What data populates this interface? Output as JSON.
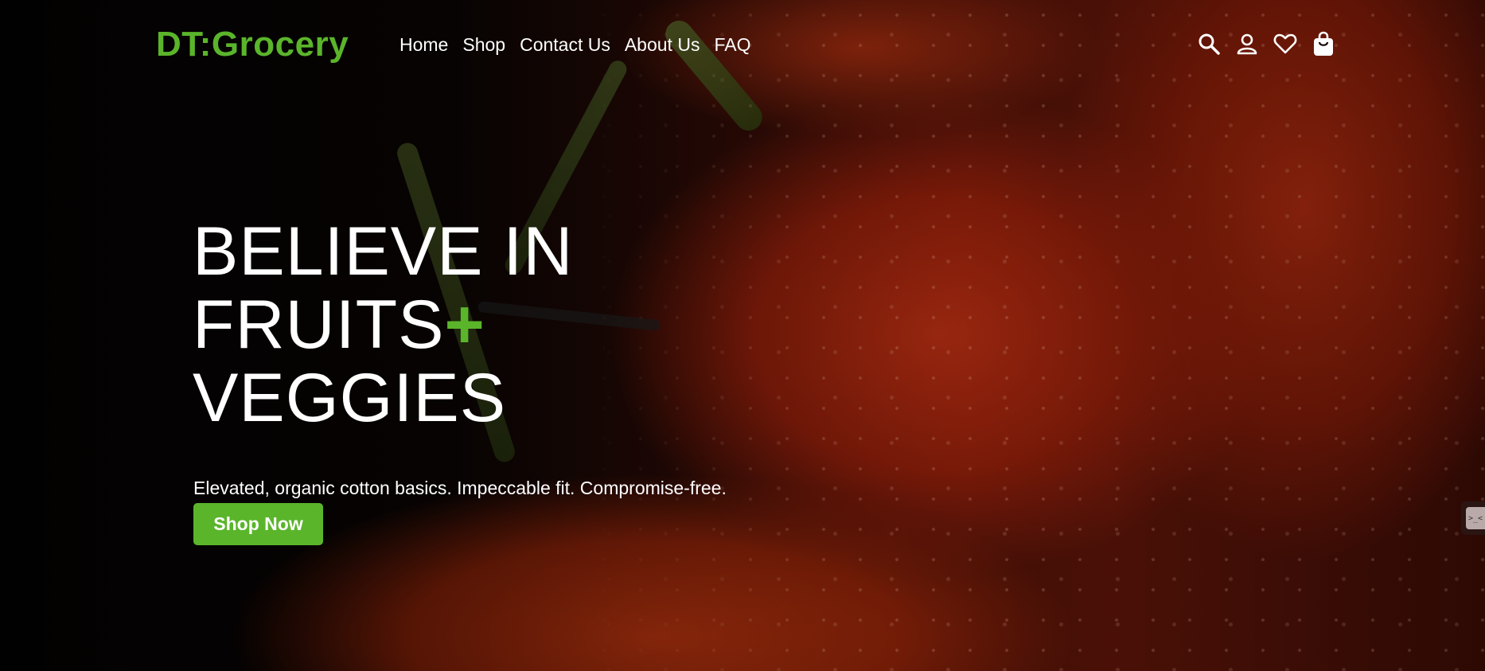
{
  "brand": {
    "logo": "DT:Grocery",
    "accent_color": "#5ab52b"
  },
  "nav": {
    "items": [
      {
        "label": "Home"
      },
      {
        "label": "Shop"
      },
      {
        "label": "Contact Us"
      },
      {
        "label": "About Us"
      },
      {
        "label": "FAQ"
      }
    ]
  },
  "header_icons": [
    "search-icon",
    "user-icon",
    "heart-icon",
    "shopping-bag-icon"
  ],
  "hero": {
    "title_line1": "BELIEVE IN",
    "title_line2": "FRUITS",
    "title_plus": "+",
    "title_line3": "VEGGIES",
    "subtitle": "Elevated, organic cotton basics. Impeccable fit. Compromise-free.",
    "cta_label": "Shop Now",
    "background": "tomatoes-photo"
  },
  "side_widget": {
    "label": ">_<"
  }
}
